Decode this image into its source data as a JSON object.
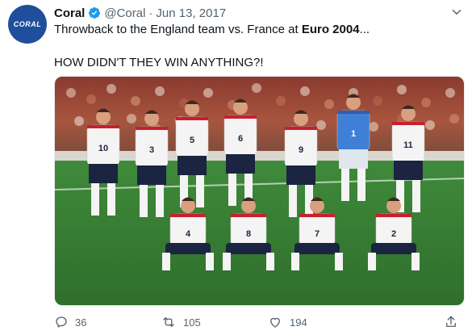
{
  "tweet": {
    "author_name": "Coral",
    "handle": "@Coral",
    "separator": "·",
    "date": "Jun 13, 2017",
    "text_before_bold": "Throwback to the England team vs. France at ",
    "text_bold": "Euro 2004",
    "text_after_bold": "...",
    "text_line2": "HOW DIDN'T THEY WIN ANYTHING?!",
    "avatar_logo_text": "CORAL",
    "media_alt": "England team photo",
    "shirt_numbers_back": [
      "10",
      "3",
      "5",
      "6",
      "9",
      "1",
      "11"
    ],
    "shirt_numbers_front": [
      "4",
      "8",
      "7",
      "2"
    ]
  },
  "actions": {
    "replies": "36",
    "retweets": "105",
    "likes": "194"
  },
  "colors": {
    "brand_avatar": "#1f4f9c",
    "verified": "#1d9bf0",
    "muted": "#536471"
  }
}
